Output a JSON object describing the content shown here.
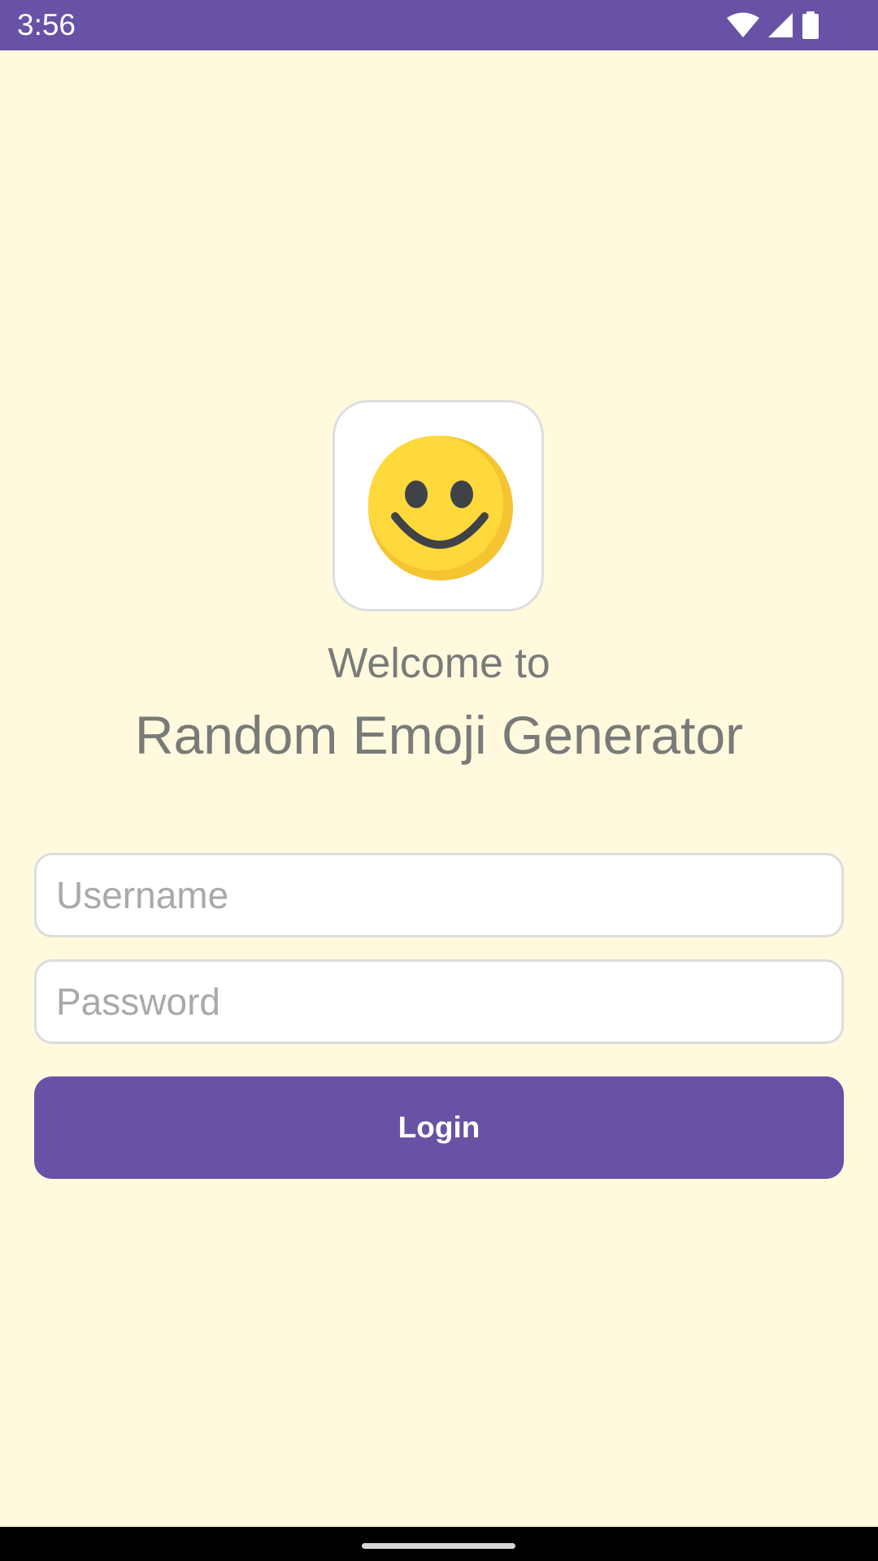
{
  "status_bar": {
    "time": "3:56",
    "icons": [
      "wifi-icon",
      "signal-icon",
      "battery-icon"
    ],
    "background_color": "#6852A5"
  },
  "app_icon": {
    "icon": "smiley-face-icon"
  },
  "welcome": {
    "line1": "Welcome to",
    "app_name": "Random Emoji Generator"
  },
  "form": {
    "username_placeholder": "Username",
    "username_value": "",
    "password_placeholder": "Password",
    "password_value": "",
    "login_label": "Login"
  },
  "colors": {
    "background": "#FFFADE",
    "accent": "#6852A5",
    "text_muted": "#7A7A78"
  }
}
